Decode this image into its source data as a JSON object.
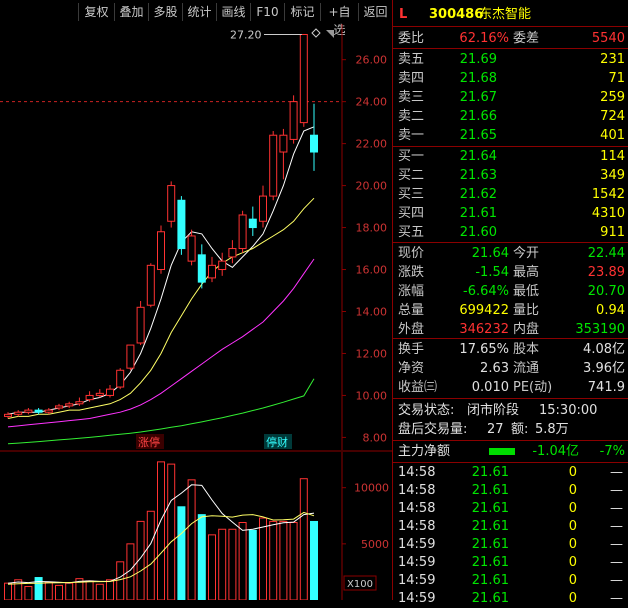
{
  "toolbar": {
    "items": [
      "复权",
      "叠加",
      "多股",
      "统计",
      "画线",
      "F10",
      "标记",
      "+自选",
      "返回"
    ]
  },
  "stock": {
    "letter": "L",
    "code": "300486",
    "name": "东杰智能"
  },
  "order_ratio": {
    "label1": "委比",
    "value1": "62.16%",
    "label2": "委差",
    "value2": "5540"
  },
  "asks": [
    {
      "label": "卖五",
      "price": "21.69",
      "vol": "231"
    },
    {
      "label": "卖四",
      "price": "21.68",
      "vol": "71"
    },
    {
      "label": "卖三",
      "price": "21.67",
      "vol": "259"
    },
    {
      "label": "卖二",
      "price": "21.66",
      "vol": "724"
    },
    {
      "label": "卖一",
      "price": "21.65",
      "vol": "401"
    }
  ],
  "bids": [
    {
      "label": "买一",
      "price": "21.64",
      "vol": "114"
    },
    {
      "label": "买二",
      "price": "21.63",
      "vol": "349"
    },
    {
      "label": "买三",
      "price": "21.62",
      "vol": "1542"
    },
    {
      "label": "买四",
      "price": "21.61",
      "vol": "4310"
    },
    {
      "label": "买五",
      "price": "21.60",
      "vol": "911"
    }
  ],
  "quote": [
    {
      "l1": "现价",
      "v1": "21.64",
      "c1": "green",
      "l2": "今开",
      "v2": "22.44",
      "c2": "green"
    },
    {
      "l1": "涨跌",
      "v1": "-1.54",
      "c1": "green",
      "l2": "最高",
      "v2": "23.89",
      "c2": "red"
    },
    {
      "l1": "涨幅",
      "v1": "-6.64%",
      "c1": "green",
      "l2": "最低",
      "v2": "20.70",
      "c2": "green"
    },
    {
      "l1": "总量",
      "v1": "699422",
      "c1": "yellow",
      "l2": "量比",
      "v2": "0.94",
      "c2": "yellow"
    },
    {
      "l1": "外盘",
      "v1": "346232",
      "c1": "red",
      "l2": "内盘",
      "v2": "353190",
      "c2": "green"
    }
  ],
  "fundamentals": [
    {
      "l1": "换手",
      "v1": "17.65%",
      "l2": "股本",
      "v2": "4.08亿"
    },
    {
      "l1": "净资",
      "v1": "2.63",
      "l2": "流通",
      "v2": "3.96亿"
    },
    {
      "l1": "收益㈢",
      "v1": "0.010",
      "l2": "PE(动)",
      "v2": "741.9"
    }
  ],
  "status": {
    "state_label": "交易状态:",
    "state_value": "闭市阶段",
    "time": "15:30:00",
    "after_label": "盘后交易量:",
    "after_vol": "27",
    "amount_label": "额:",
    "amount": "5.8万"
  },
  "main_force": {
    "label": "主力净额",
    "value": "-1.04亿",
    "pct": "-7%"
  },
  "ticks": [
    {
      "time": "14:58",
      "price": "21.61",
      "vol": "0",
      "flag": "—"
    },
    {
      "time": "14:58",
      "price": "21.61",
      "vol": "0",
      "flag": "—"
    },
    {
      "time": "14:58",
      "price": "21.61",
      "vol": "0",
      "flag": "—"
    },
    {
      "time": "14:58",
      "price": "21.61",
      "vol": "0",
      "flag": "—"
    },
    {
      "time": "14:59",
      "price": "21.61",
      "vol": "0",
      "flag": "—"
    },
    {
      "time": "14:59",
      "price": "21.61",
      "vol": "0",
      "flag": "—"
    },
    {
      "time": "14:59",
      "price": "21.61",
      "vol": "0",
      "flag": "—"
    },
    {
      "time": "14:59",
      "price": "21.61",
      "vol": "0",
      "flag": "—"
    }
  ],
  "chart_data": [
    {
      "type": "candlestick",
      "y_ticks": [
        "26.00",
        "24.00",
        "22.00",
        "20.00",
        "18.00",
        "16.00",
        "14.00",
        "12.00",
        "10.00",
        "8.00"
      ],
      "ylim": [
        7.4,
        27.7
      ],
      "dashed_level": 24.0,
      "max_label": "27.20",
      "tags": [
        "涨停",
        "停财"
      ],
      "candles": [
        {
          "o": 9.0,
          "c": 9.1,
          "h": 9.2,
          "l": 8.9
        },
        {
          "o": 9.1,
          "c": 9.2,
          "h": 9.3,
          "l": 9.0
        },
        {
          "o": 9.2,
          "c": 9.3,
          "h": 9.4,
          "l": 9.1
        },
        {
          "o": 9.3,
          "c": 9.2,
          "h": 9.4,
          "l": 9.1
        },
        {
          "o": 9.2,
          "c": 9.3,
          "h": 9.4,
          "l": 9.1
        },
        {
          "o": 9.4,
          "c": 9.5,
          "h": 9.6,
          "l": 9.3
        },
        {
          "o": 9.5,
          "c": 9.6,
          "h": 9.7,
          "l": 9.4
        },
        {
          "o": 9.6,
          "c": 9.7,
          "h": 9.9,
          "l": 9.5
        },
        {
          "o": 9.8,
          "c": 10.0,
          "h": 10.2,
          "l": 9.7
        },
        {
          "o": 10.0,
          "c": 10.1,
          "h": 10.3,
          "l": 9.9
        },
        {
          "o": 10.0,
          "c": 10.3,
          "h": 10.5,
          "l": 9.9
        },
        {
          "o": 10.4,
          "c": 11.2,
          "h": 11.3,
          "l": 10.3
        },
        {
          "o": 11.3,
          "c": 12.4,
          "h": 12.4,
          "l": 11.2
        },
        {
          "o": 12.5,
          "c": 14.2,
          "h": 14.5,
          "l": 12.4
        },
        {
          "o": 14.3,
          "c": 16.2,
          "h": 16.3,
          "l": 14.2
        },
        {
          "o": 16.0,
          "c": 17.8,
          "h": 18.1,
          "l": 15.8
        },
        {
          "o": 18.3,
          "c": 20.0,
          "h": 20.2,
          "l": 18.0
        },
        {
          "o": 19.3,
          "c": 17.0,
          "h": 19.5,
          "l": 16.7
        },
        {
          "o": 16.4,
          "c": 17.6,
          "h": 17.9,
          "l": 16.2
        },
        {
          "o": 16.7,
          "c": 15.4,
          "h": 17.2,
          "l": 15.1
        },
        {
          "o": 15.6,
          "c": 16.2,
          "h": 16.6,
          "l": 15.4
        },
        {
          "o": 16.0,
          "c": 16.4,
          "h": 16.8,
          "l": 15.7
        },
        {
          "o": 16.6,
          "c": 17.0,
          "h": 17.4,
          "l": 16.3
        },
        {
          "o": 17.0,
          "c": 18.6,
          "h": 18.8,
          "l": 16.8
        },
        {
          "o": 18.4,
          "c": 18.0,
          "h": 19.0,
          "l": 17.6
        },
        {
          "o": 18.3,
          "c": 19.5,
          "h": 20.0,
          "l": 18.0
        },
        {
          "o": 19.5,
          "c": 22.4,
          "h": 22.6,
          "l": 19.3
        },
        {
          "o": 21.6,
          "c": 22.4,
          "h": 22.7,
          "l": 20.3
        },
        {
          "o": 22.2,
          "c": 24.0,
          "h": 24.3,
          "l": 22.0
        },
        {
          "o": 23.0,
          "c": 27.2,
          "h": 27.2,
          "l": 22.8
        },
        {
          "o": 22.4,
          "c": 21.6,
          "h": 23.9,
          "l": 20.7
        }
      ],
      "ma": [
        {
          "name": "MA5",
          "color": "#ffffff",
          "values": [
            9.1,
            9.2,
            9.2,
            9.2,
            9.3,
            9.4,
            9.5,
            9.6,
            9.8,
            9.9,
            10.1,
            10.5,
            11.1,
            12.0,
            13.2,
            14.6,
            16.2,
            17.3,
            17.8,
            17.7,
            17.0,
            16.4,
            16.1,
            16.6,
            17.1,
            17.7,
            18.8,
            20.0,
            21.5,
            22.6,
            22.8
          ]
        },
        {
          "name": "MA10",
          "color": "#ffff66",
          "values": [
            8.9,
            9.0,
            9.0,
            9.1,
            9.1,
            9.2,
            9.3,
            9.3,
            9.4,
            9.5,
            9.6,
            9.8,
            10.1,
            10.6,
            11.2,
            12.0,
            13.0,
            13.8,
            14.6,
            15.3,
            15.9,
            16.3,
            16.6,
            16.8,
            17.0,
            17.3,
            17.6,
            17.9,
            18.3,
            18.9,
            19.4
          ]
        },
        {
          "name": "MA20",
          "color": "#ff33ff",
          "values": [
            8.5,
            8.55,
            8.6,
            8.65,
            8.7,
            8.75,
            8.8,
            8.85,
            8.9,
            9.0,
            9.1,
            9.2,
            9.35,
            9.55,
            9.8,
            10.1,
            10.45,
            10.8,
            11.15,
            11.5,
            11.85,
            12.2,
            12.5,
            12.8,
            13.15,
            13.5,
            14.0,
            14.5,
            15.1,
            15.8,
            16.5
          ]
        },
        {
          "name": "MA60",
          "color": "#33ee33",
          "values": [
            7.7,
            7.73,
            7.76,
            7.8,
            7.84,
            7.88,
            7.92,
            7.96,
            8.0,
            8.05,
            8.1,
            8.15,
            8.2,
            8.26,
            8.33,
            8.4,
            8.48,
            8.56,
            8.65,
            8.74,
            8.84,
            8.94,
            9.05,
            9.16,
            9.28,
            9.4,
            9.54,
            9.68,
            9.83,
            9.98,
            10.8
          ]
        }
      ]
    },
    {
      "type": "bar",
      "y_ticks": [
        "10000",
        "5000"
      ],
      "unit": "X100",
      "ylim": [
        0,
        13000
      ],
      "values": [
        1500,
        1800,
        1200,
        2000,
        1600,
        1300,
        1500,
        1900,
        1700,
        1400,
        1800,
        3400,
        5000,
        7000,
        7900,
        12300,
        12100,
        8300,
        10700,
        7600,
        5800,
        6300,
        6300,
        6900,
        6200,
        7300,
        7000,
        7000,
        6900,
        10800,
        6992
      ],
      "up": [
        true,
        true,
        true,
        false,
        true,
        true,
        true,
        true,
        true,
        true,
        true,
        true,
        true,
        true,
        true,
        true,
        true,
        false,
        true,
        false,
        true,
        true,
        true,
        true,
        false,
        true,
        true,
        true,
        true,
        true,
        false
      ],
      "ma": [
        {
          "name": "VMA5",
          "color": "#ffffff",
          "values": [
            1500,
            1600,
            1550,
            1650,
            1620,
            1580,
            1520,
            1660,
            1700,
            1660,
            1660,
            2040,
            2660,
            3740,
            5020,
            7120,
            8860,
            9520,
            10260,
            10200,
            8900,
            7700,
            6940,
            6200,
            6300,
            6500,
            6700,
            6880,
            6940,
            7600,
            7740
          ]
        },
        {
          "name": "VMA10",
          "color": "#ffff66",
          "values": [
            1400,
            1450,
            1480,
            1500,
            1520,
            1540,
            1560,
            1580,
            1620,
            1640,
            1650,
            1820,
            2070,
            2580,
            3200,
            4180,
            5180,
            5920,
            6800,
            7400,
            7500,
            7460,
            7380,
            7560,
            7600,
            7400,
            7120,
            7150,
            7200,
            7800,
            7500
          ]
        }
      ]
    }
  ]
}
